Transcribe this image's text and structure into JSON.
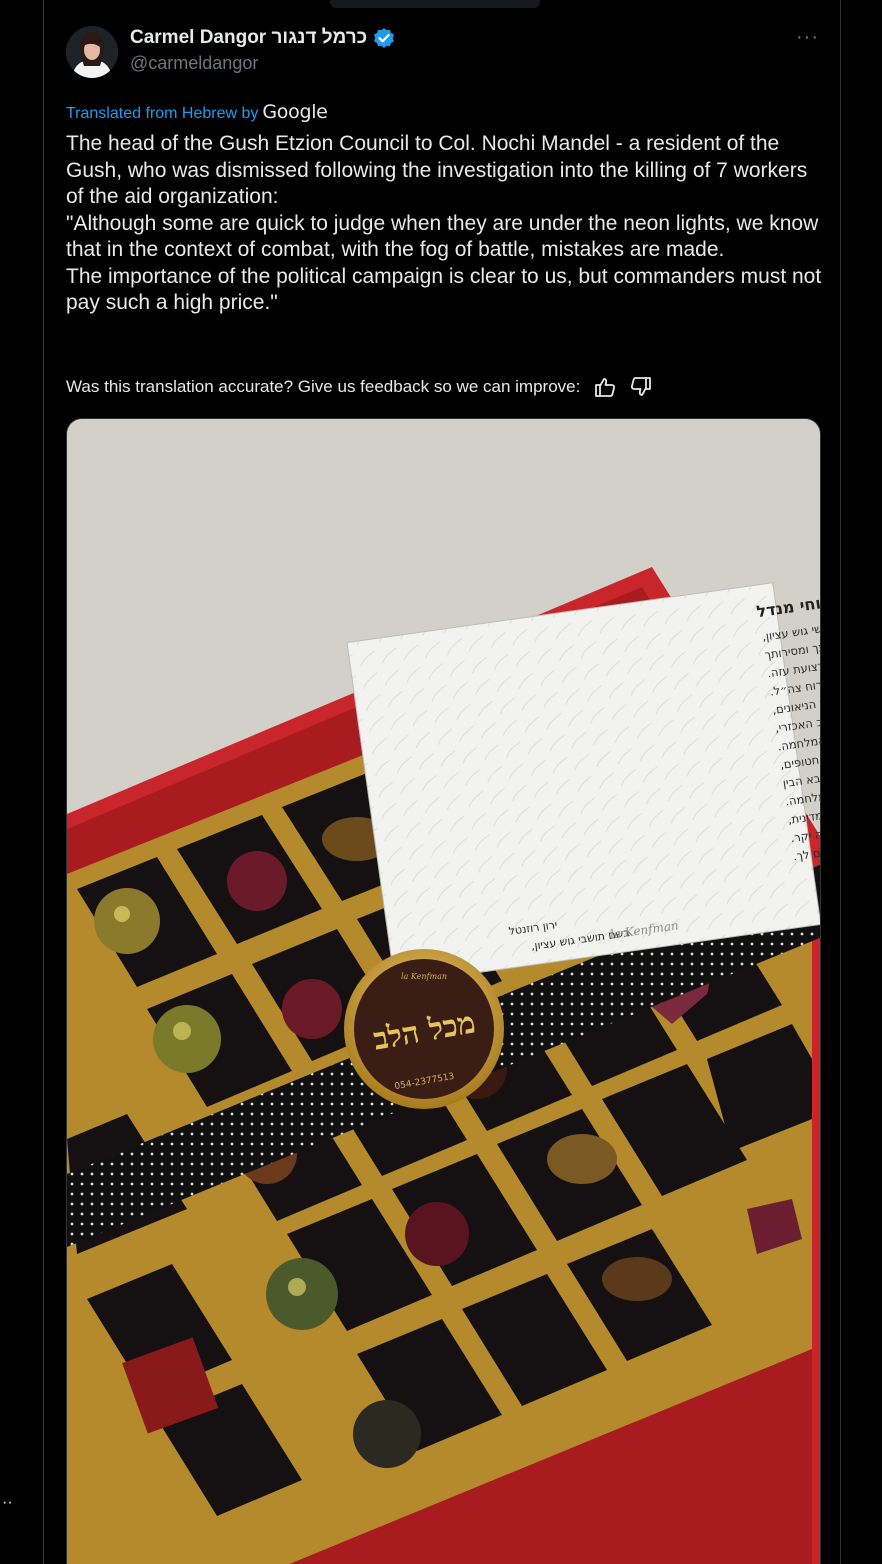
{
  "tweet": {
    "display_name": "Carmel Dangor כרמל דנגור",
    "handle": "@carmeldangor",
    "more_label": "···",
    "translated_label": "Translated from Hebrew by",
    "translator": "Google",
    "text": "The head of the Gush Etzion Council to Col. Nochi Mandel - a resident of the Gush, who was dismissed following the investigation into the killing of 7 workers of the aid organization:\n\"Although some are quick to judge when they are under the neon lights, we know that in the context of combat, with the fog of battle, mistakes are made.\nThe importance of the political campaign is clear to us, but commanders must not pay such a high price.\"",
    "feedback_prompt": "Was this translation accurate? Give us feedback so we can improve:",
    "edge_dots": "··"
  },
  "photo": {
    "card_title": "לשכננו וחברנו אל״מ (מיל) נוחי מנדל",
    "card_lines": [
      "את הערכה מאיתנו אנשי גוש עציון,",
      "שלוחה לך על תרומתך ומסירותך",
      "במלחמה ברצועת עזה.",
      "אנו בטוחים שתמיד פעלת בהתאם לרוח צה״ל.",
      "אך אנו שהשתתפנו בקרבות ולחמנו תחת הניאונים,",
      "יודעים שבמסגרת הלחימה, נגד האויב האכזרי,",
      "נעשות טעויות וזה חלק ממחיר המלחמה.",
      "לצערנו כוחות צה״ל הרגו בשוגג חטופים,",
      "חיילים נהרגו מאש כוחותינו ופיקוד הצבא הבין",
      "שלצערנו זה חלק מהמלחמה.",
      "ברורה לנו חשיבותה של המערכה המדינית,",
      "אך אסור שלוחמים ומפקדים ישלמו מחיר כה יקר.",
      "אנו שולחים לך חיבוק חם ומצדיעים לך."
    ],
    "card_signature": "ירון רוזנטל",
    "card_signature_sub": "בשם תושבי גוש עציון,",
    "seal_text": "מכל הלב",
    "seal_phone": "054-2377513",
    "seal_brand": "la Kenfman",
    "card_brand": "la Kenfman"
  },
  "colors": {
    "background": "#000000",
    "text": "#e7e9ea",
    "muted": "#71767b",
    "link": "#1d9bf0",
    "verified": "#1d9bf0",
    "box_red": "#c8262a",
    "seal_gold": "#d4a52a",
    "seal_inner": "#3a1d14"
  }
}
